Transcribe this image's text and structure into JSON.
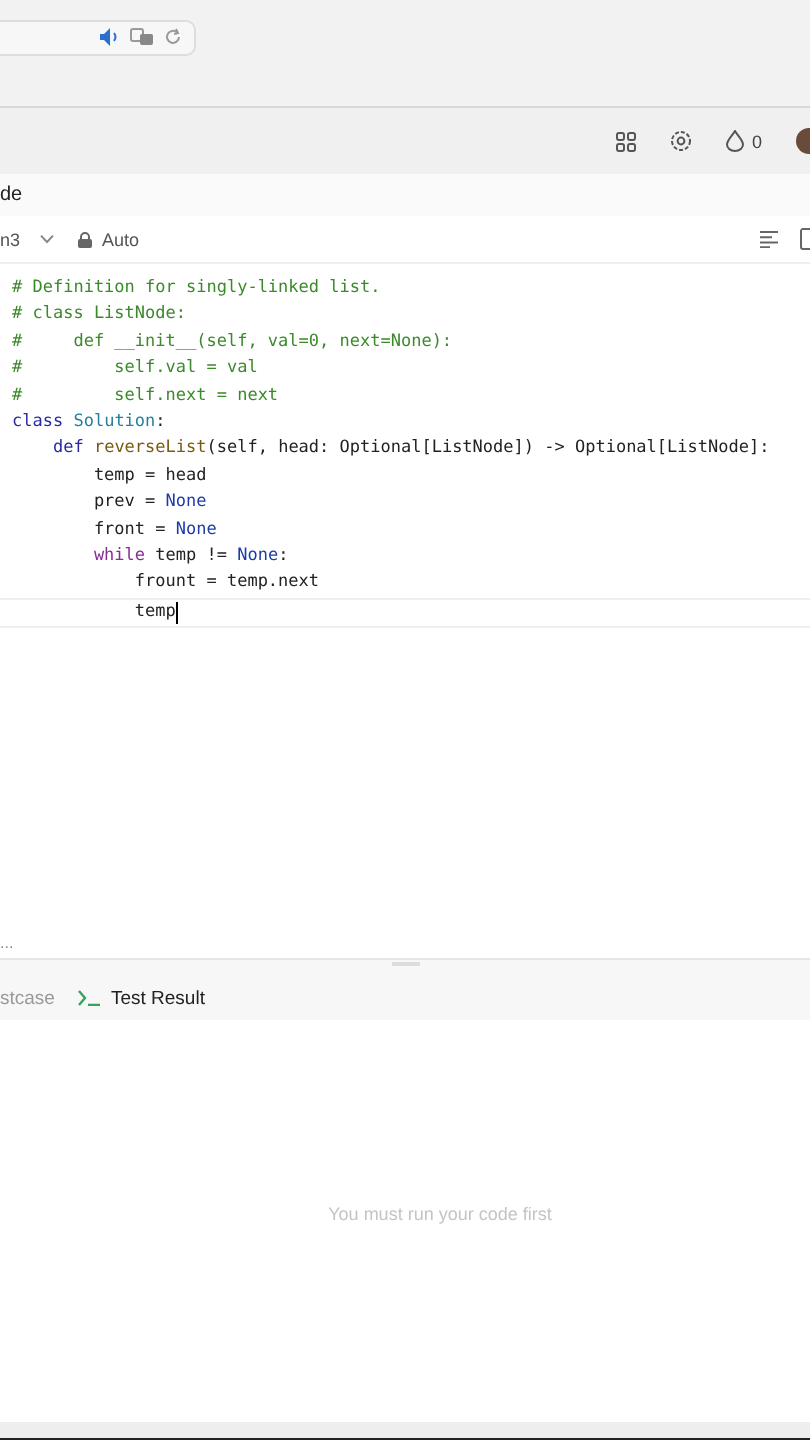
{
  "toolbar": {
    "coins": "0"
  },
  "tab": {
    "label": "de"
  },
  "editor_bar": {
    "language": "n3",
    "mode": "Auto"
  },
  "code": [
    {
      "cursor": false,
      "tokens": [
        {
          "text": "# Definition for singly-linked list.",
          "kind": "comment"
        }
      ]
    },
    {
      "cursor": false,
      "tokens": [
        {
          "text": "# class ListNode:",
          "kind": "comment"
        }
      ]
    },
    {
      "cursor": false,
      "tokens": [
        {
          "text": "#     def __init__(self, val=0, next=None):",
          "kind": "comment"
        }
      ]
    },
    {
      "cursor": false,
      "tokens": [
        {
          "text": "#         self.val = val",
          "kind": "comment"
        }
      ]
    },
    {
      "cursor": false,
      "tokens": [
        {
          "text": "#         self.next = next",
          "kind": "comment"
        }
      ]
    },
    {
      "cursor": false,
      "tokens": [
        {
          "text": "class ",
          "kind": "keyword"
        },
        {
          "text": "Solution",
          "kind": "class"
        },
        {
          "text": ":",
          "kind": "plain"
        }
      ]
    },
    {
      "cursor": false,
      "tokens": [
        {
          "text": "    def ",
          "kind": "keyword"
        },
        {
          "text": "reverseList",
          "kind": "function"
        },
        {
          "text": "(self, head: Optional[ListNode]) -> Optional[ListNode]:",
          "kind": "plain"
        }
      ]
    },
    {
      "cursor": false,
      "tokens": [
        {
          "text": "        temp = head",
          "kind": "plain"
        }
      ]
    },
    {
      "cursor": false,
      "tokens": [
        {
          "text": "        prev = ",
          "kind": "plain"
        },
        {
          "text": "None",
          "kind": "constant"
        }
      ]
    },
    {
      "cursor": false,
      "tokens": [
        {
          "text": "        front = ",
          "kind": "plain"
        },
        {
          "text": "None",
          "kind": "constant"
        }
      ]
    },
    {
      "cursor": false,
      "tokens": [
        {
          "text": "        while",
          "kind": "control"
        },
        {
          "text": " temp != ",
          "kind": "plain"
        },
        {
          "text": "None",
          "kind": "constant"
        },
        {
          "text": ":",
          "kind": "plain"
        }
      ]
    },
    {
      "cursor": false,
      "tokens": [
        {
          "text": "            frount = temp.next",
          "kind": "plain"
        }
      ]
    },
    {
      "cursor": true,
      "tokens": [
        {
          "text": "            temp",
          "kind": "plain"
        }
      ]
    }
  ],
  "editor_footer": "...",
  "bottom_tabs": [
    {
      "label": "stcase",
      "kind": "testcase",
      "selected": false
    },
    {
      "label": "Test Result",
      "kind": "result",
      "selected": true
    }
  ],
  "result_message": "You must run your code first"
}
